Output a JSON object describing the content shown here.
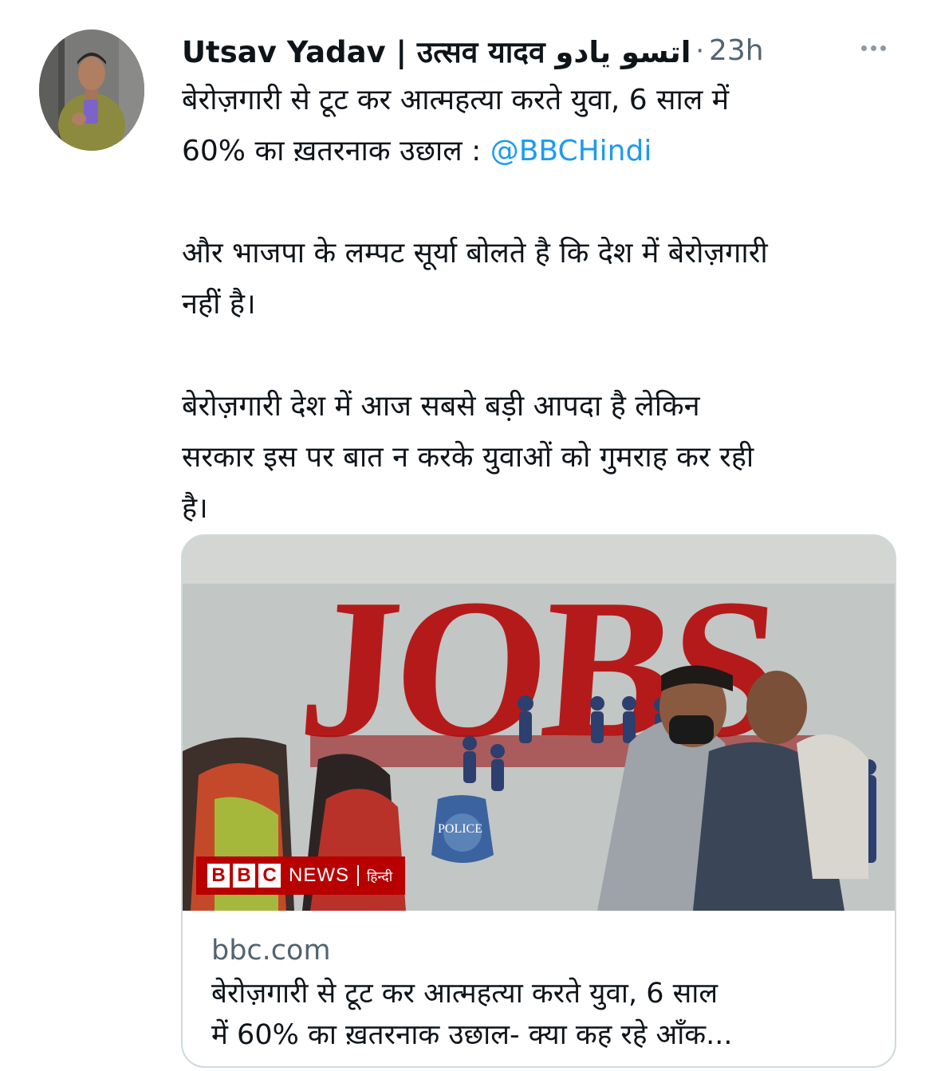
{
  "tweet": {
    "author_name": "Utsav Yadav | उत्सव यादव اتسو یادو",
    "separator": "·",
    "time": "23h",
    "avatar_icon": "user-avatar-photo",
    "more_icon": "more-horizontal-icon",
    "text": {
      "line1": "बेरोज़गारी से टूट कर आत्महत्या करते युवा, 6 साल में",
      "line2_prefix": "60% का ख़तरनाक उछाल : ",
      "mention": "@BBCHindi",
      "para2_line1": "और भाजपा के लम्पट सूर्या बोलते है कि देश में बेरोज़गारी",
      "para2_line2": "नहीं है।",
      "para3_line1": "बेरोज़गारी देश में आज सबसे बड़ी आपदा है लेकिन",
      "para3_line2": "सरकार इस पर बात न करके युवाओं को गुमराह कर रही",
      "para3_line3": "है।"
    }
  },
  "card": {
    "image_sign_text": "JOBS",
    "badge_text": "POLICE",
    "bbc_letters": [
      "B",
      "B",
      "C"
    ],
    "bbc_news": "NEWS",
    "bbc_lang": "हिन्दी",
    "domain": "bbc.com",
    "title_line1": "बेरोज़गारी से टूट कर आत्महत्या करते युवा, 6 साल",
    "title_line2": "में 60% का ख़तरनाक उछाल- क्या कह रहे आँक..."
  },
  "colors": {
    "link": "#1d9bf0",
    "secondary_text": "#536471",
    "bbc_red": "#b80000",
    "jobs_red": "#c8201e"
  }
}
